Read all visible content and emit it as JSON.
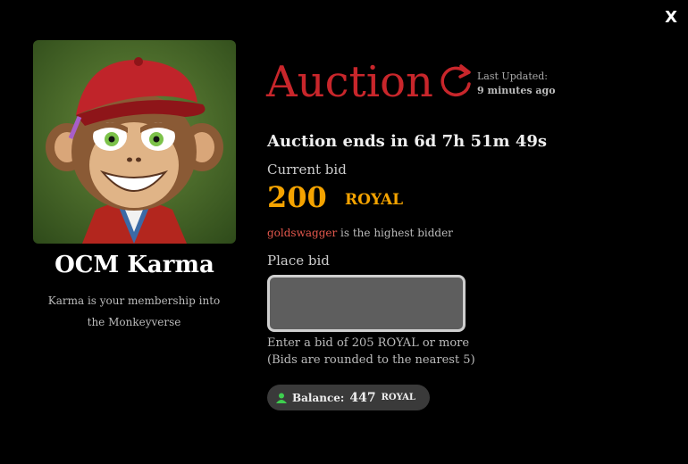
{
  "close_label": "X",
  "nft": {
    "name": "OCM Karma",
    "description": "Karma is your membership into the Monkeyverse"
  },
  "auction": {
    "title": "Auction",
    "last_updated_label": "Last Updated:",
    "last_updated_value": "9 minutes ago",
    "ends_in": "Auction ends in 6d 7h 51m 49s",
    "current_bid_label": "Current bid",
    "current_bid_amount": "200",
    "currency": "ROYAL",
    "highest_bidder": "goldswagger",
    "highest_bidder_suffix": "is the highest bidder",
    "place_bid_label": "Place bid",
    "bid_input_value": "",
    "hint_line1": "Enter a bid of 205 ROYAL or more",
    "hint_line2": "(Bids are rounded to the nearest 5)"
  },
  "balance": {
    "label": "Balance:",
    "amount": "447",
    "currency": "ROYAL",
    "icon": "user-icon",
    "icon_color": "#3ecf4f"
  },
  "colors": {
    "background": "#000000",
    "auction_title": "#c8262b",
    "bid_amount": "#f4a300",
    "bidder_name": "#e2574c"
  }
}
